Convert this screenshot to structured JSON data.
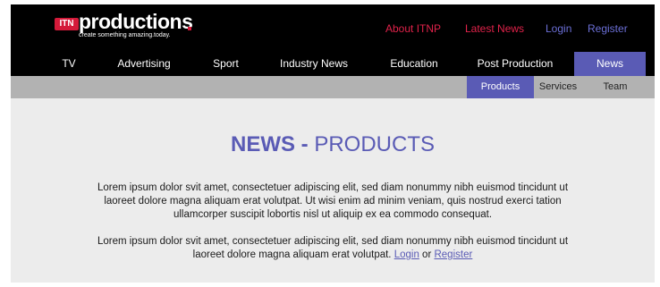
{
  "logo": {
    "badge": "ITN",
    "word": "productions",
    "tagline": "create something amazing.today."
  },
  "toplinks": [
    {
      "label": "About ITNP",
      "color": "#e0224a"
    },
    {
      "label": "Latest News",
      "color": "#e0224a"
    },
    {
      "label": "Login",
      "color": "#6b6fd6"
    },
    {
      "label": "Register",
      "color": "#6b6fd6"
    }
  ],
  "mainnav": [
    {
      "label": "TV"
    },
    {
      "label": "Advertising"
    },
    {
      "label": "Sport"
    },
    {
      "label": "Industry News"
    },
    {
      "label": "Education"
    },
    {
      "label": "Post Production"
    },
    {
      "label": "News",
      "active": true
    }
  ],
  "subnav": [
    {
      "label": "Products",
      "active": true
    },
    {
      "label": "Services"
    },
    {
      "label": "Team"
    }
  ],
  "page": {
    "title_bold": "NEWS -",
    "title_rest": " PRODUCTS",
    "para1": "Lorem ipsum dolor svit amet, consectetuer adipiscing elit, sed diam nonummy nibh euismod tincidunt ut laoreet dolore magna aliquam erat volutpat. Ut wisi enim ad minim veniam, quis nostrud exerci tation ullamcorper suscipit lobortis nisl ut aliquip ex ea commodo consequat.",
    "para2": "Lorem ipsum dolor svit amet, consectetuer adipiscing elit, sed diam nonummy nibh euismod tincidunt ut laoreet dolore magna aliquam erat volutpat.",
    "para2_link1": "Login",
    "para2_or": " or ",
    "para2_link2": "Register"
  },
  "colors": {
    "accent": "#5a5bb5",
    "brand_red": "#d41a3a"
  }
}
